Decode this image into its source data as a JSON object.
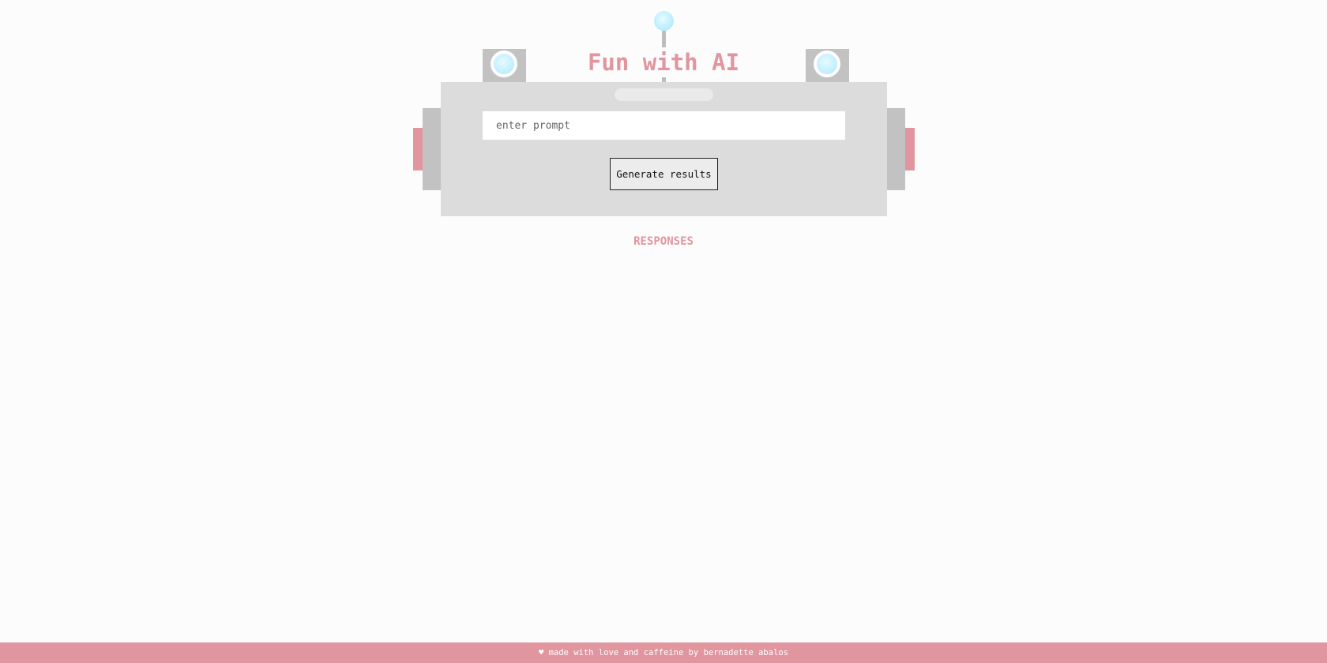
{
  "app": {
    "title": "Fun with AI"
  },
  "form": {
    "prompt_placeholder": "enter prompt",
    "prompt_value": "",
    "generate_label": "Generate results"
  },
  "responses": {
    "heading": "RESPONSES",
    "items": []
  },
  "footer": {
    "text": "♥ made with love and caffeine by bernadette abalos"
  },
  "icons": {
    "antenna": "antenna-ball-icon",
    "left_eye": "robot-eye-icon",
    "right_eye": "robot-eye-icon"
  },
  "colors": {
    "accent": "#e0959f",
    "robot_gray": "#c2c2c2",
    "panel_gray": "#dcdcdc",
    "eye_blue": "#bfefff",
    "background": "#fcfcfc"
  }
}
